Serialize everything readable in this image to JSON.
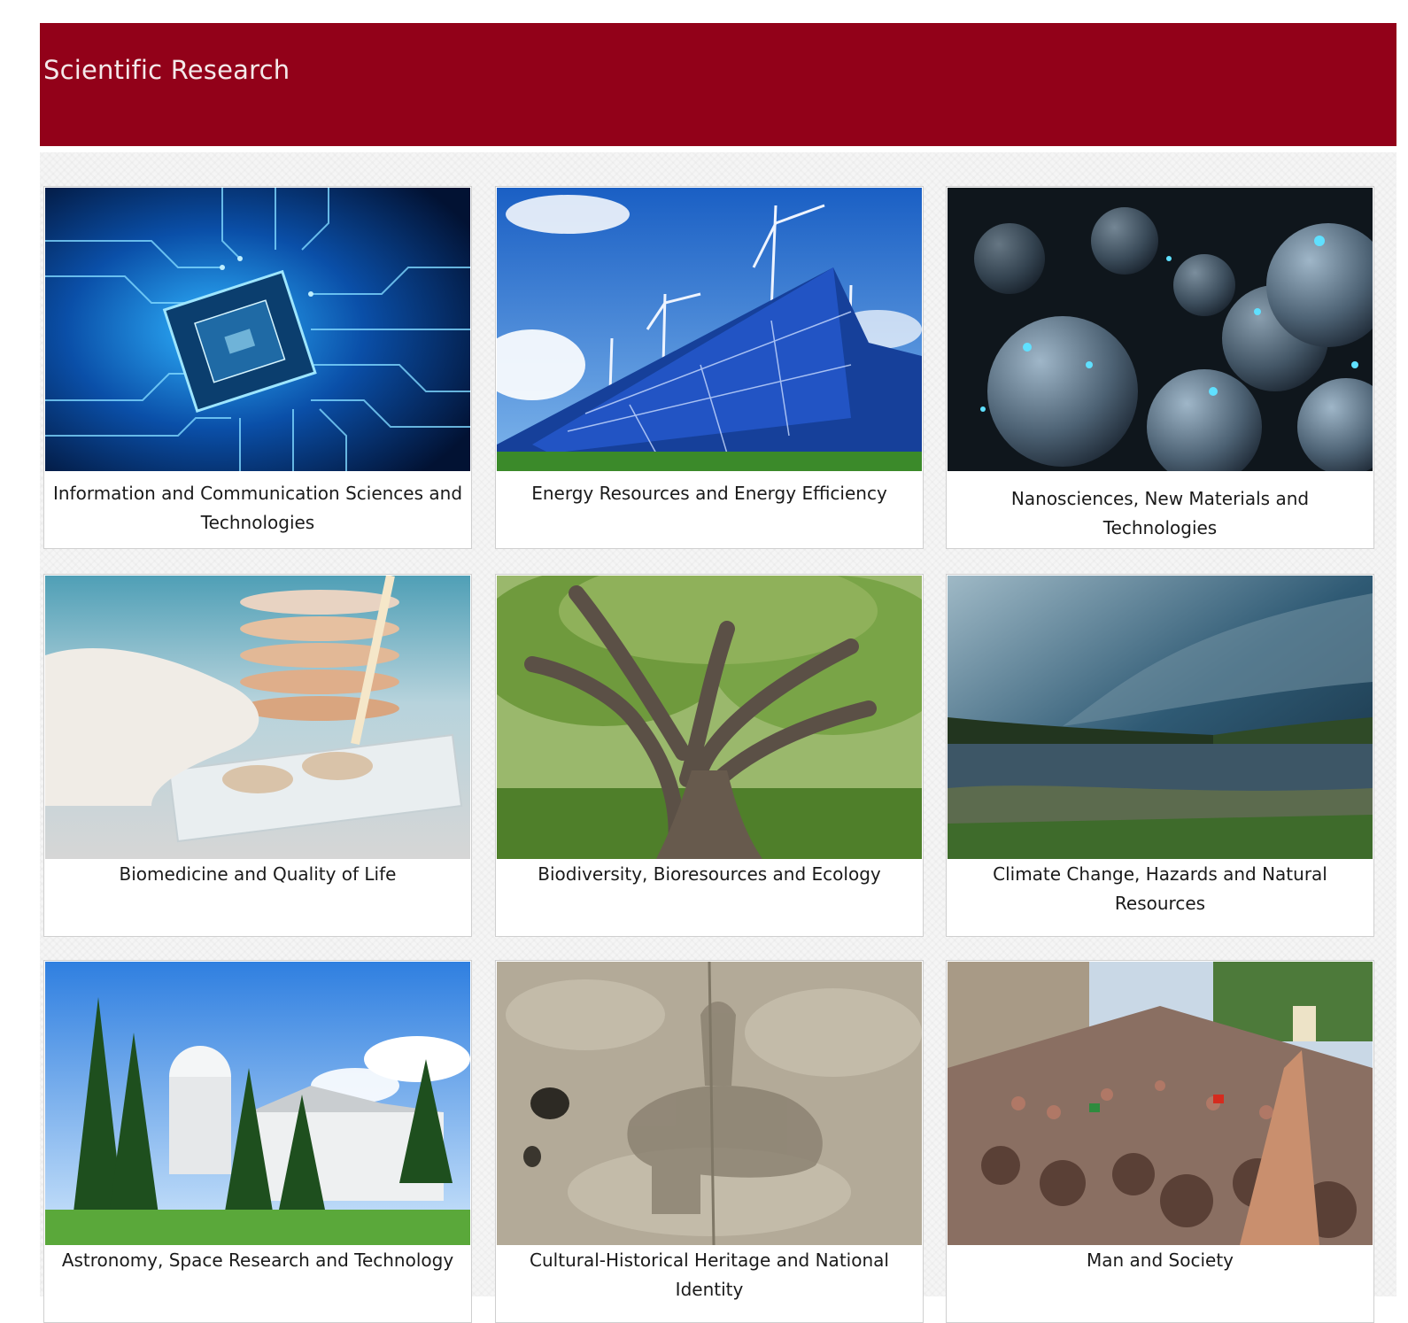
{
  "header": {
    "title": "Scientific Research",
    "background_color": "#920119"
  },
  "cards": [
    {
      "caption": "Information and Communication Sciences and Technologies",
      "image": "circuit-board-chip-photo"
    },
    {
      "caption": "Energy Resources and Energy Efficiency",
      "image": "solar-panels-wind-turbines-photo"
    },
    {
      "caption": "Nanosciences, New Materials and Technologies",
      "image": "nano-spheres-photo"
    },
    {
      "caption": "Biomedicine and Quality of Life",
      "image": "laboratory-petri-dish-photo"
    },
    {
      "caption": "Biodiversity, Bioresources and Ecology",
      "image": "old-oak-tree-photo"
    },
    {
      "caption": "Climate Change, Hazards and Natural Resources",
      "image": "storm-over-river-photo"
    },
    {
      "caption": "Astronomy, Space Research and Technology",
      "image": "observatory-in-forest-photo"
    },
    {
      "caption": "Cultural-Historical Heritage and National Identity",
      "image": "rock-relief-horseman-photo"
    },
    {
      "caption": "Man and Society",
      "image": "protest-crowd-photo"
    }
  ]
}
